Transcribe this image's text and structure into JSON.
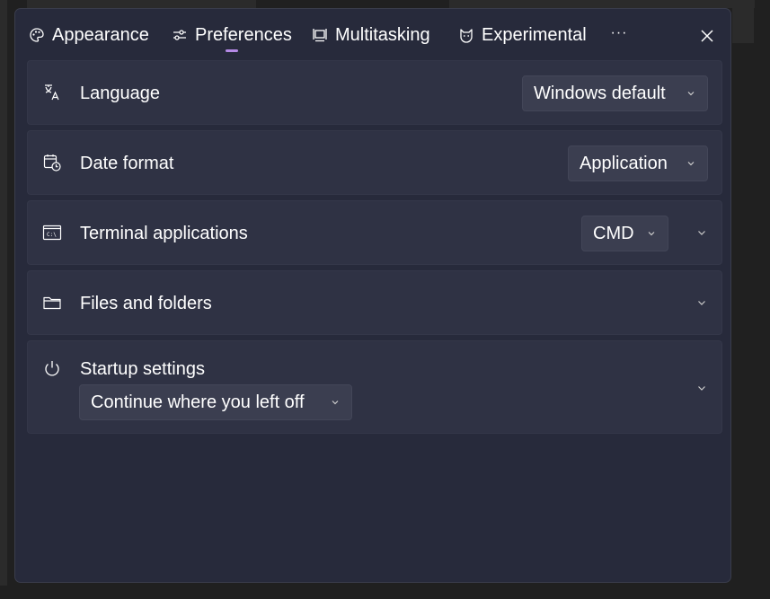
{
  "tabs": [
    {
      "label": "Appearance",
      "icon": "palette-icon"
    },
    {
      "label": "Preferences",
      "icon": "sliders-icon"
    },
    {
      "label": "Multitasking",
      "icon": "multitasking-icon"
    },
    {
      "label": "Experimental",
      "icon": "cat-icon"
    }
  ],
  "more_label": "···",
  "active_tab": "Preferences",
  "settings": {
    "language": {
      "label": "Language",
      "value": "Windows default"
    },
    "date_format": {
      "label": "Date format",
      "value": "Application"
    },
    "terminal": {
      "label": "Terminal applications",
      "value": "CMD"
    },
    "files": {
      "label": "Files and folders"
    },
    "startup": {
      "label": "Startup settings",
      "value": "Continue where you left off"
    }
  },
  "colors": {
    "dialog_bg": "#272a3b",
    "card_bg": "#2f3244",
    "accent": "#b58ae6"
  }
}
